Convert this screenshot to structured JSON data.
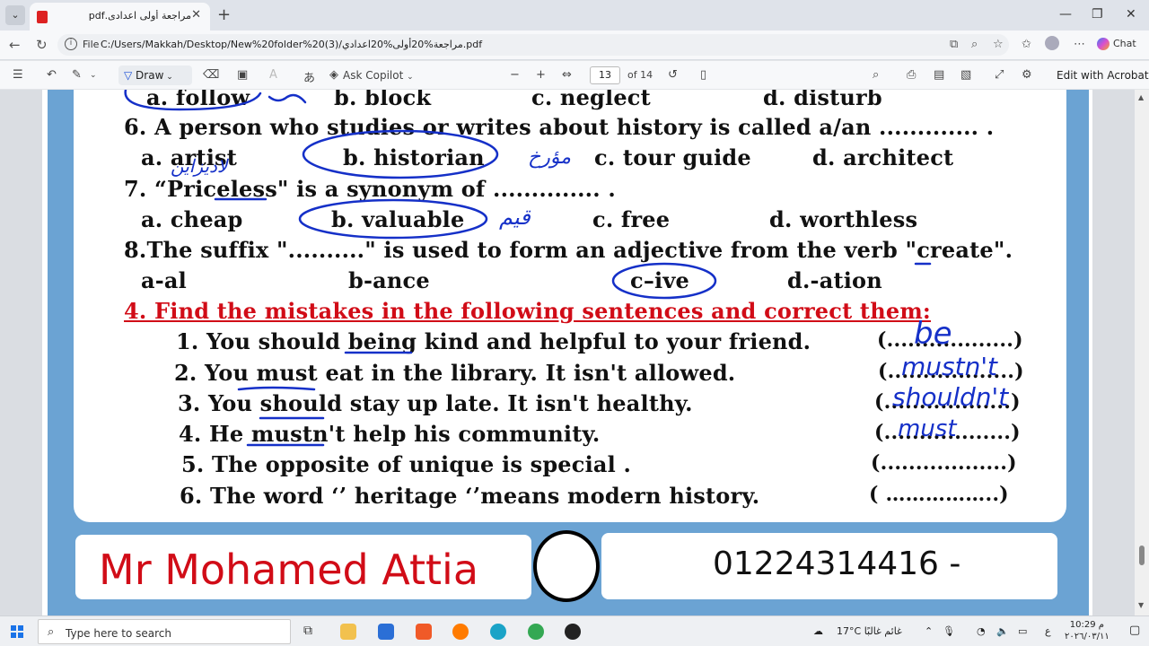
{
  "browser": {
    "tab_title": "مراجعة أولى اعدادى.pdf",
    "tab_close": "✕",
    "new_tab": "+",
    "window_controls": [
      "—",
      "❐",
      "✕"
    ],
    "address_prefix": "File",
    "url": "C:/Users/Makkah/Desktop/New%20folder%20(3)/مراجعة%20أولى%20اعدادي.pdf",
    "chat_label": "Chat"
  },
  "pdf_toolbar": {
    "draw_label": "Draw",
    "ask_copilot_label": "Ask Copilot",
    "page_current": "13",
    "page_total": "of 14",
    "edit_acrobat_label": "Edit with Acrobat"
  },
  "document": {
    "q5_options": {
      "a": "a. follow",
      "b": "b. block",
      "c": "c. neglect",
      "d": "d. disturb"
    },
    "q6": "6. A person who studies or writes about history is called a/an ............. .",
    "q6_options": {
      "a": "a. artist",
      "b": "b. historian",
      "c": "c. tour guide",
      "d": "d. architect"
    },
    "q7": "7. “Priceless\" is a synonym of .............. .",
    "q7_options": {
      "a": "a. cheap",
      "b": "b. valuable",
      "c": "c. free",
      "d": "d. worthless"
    },
    "q8": "8.The suffix \"..........\" is used to form an adjective from the verb \"create\".",
    "q8_options": {
      "a": "a-al",
      "b": "b-ance",
      "c": "c–ive",
      "d": "d.-ation"
    },
    "section4_title": "4. Find the mistakes in the following sentences and correct them:",
    "sentences": [
      "1.  You should being kind and helpful to your friend.",
      "2.  You must eat in the library. It isn't allowed.",
      "3.  You should stay up late. It isn't healthy.",
      "4.  He mustn't help his community.",
      "5.  The opposite of unique is special .",
      "6.  The word ‘’ heritage ‘’means modern history."
    ],
    "blanks": [
      "(..................)",
      "(..................)",
      "(..................)",
      "(..................)",
      "(..................)",
      "( ……………..)"
    ],
    "handwriting": {
      "h1": "be",
      "h2": "mustn't",
      "h3": "shouldn't",
      "h4": "must",
      "ar_q6a": "لاديزاين",
      "ar_q6c": "مؤرخ",
      "ar_q7": "قيم"
    },
    "teacher_name": "Mr Mohamed Attia",
    "phone": "01224314416 -"
  },
  "taskbar": {
    "search_placeholder": "Type here to search",
    "weather": "17°C  غائم غالبًا",
    "lang": "ع",
    "time": "10:29 م",
    "date": "٢٠٢٦/٠٣/١١"
  },
  "colors": {
    "accent_red": "#d10c17",
    "ink_blue": "#1530c8",
    "panel_blue": "#6ba3d3"
  }
}
